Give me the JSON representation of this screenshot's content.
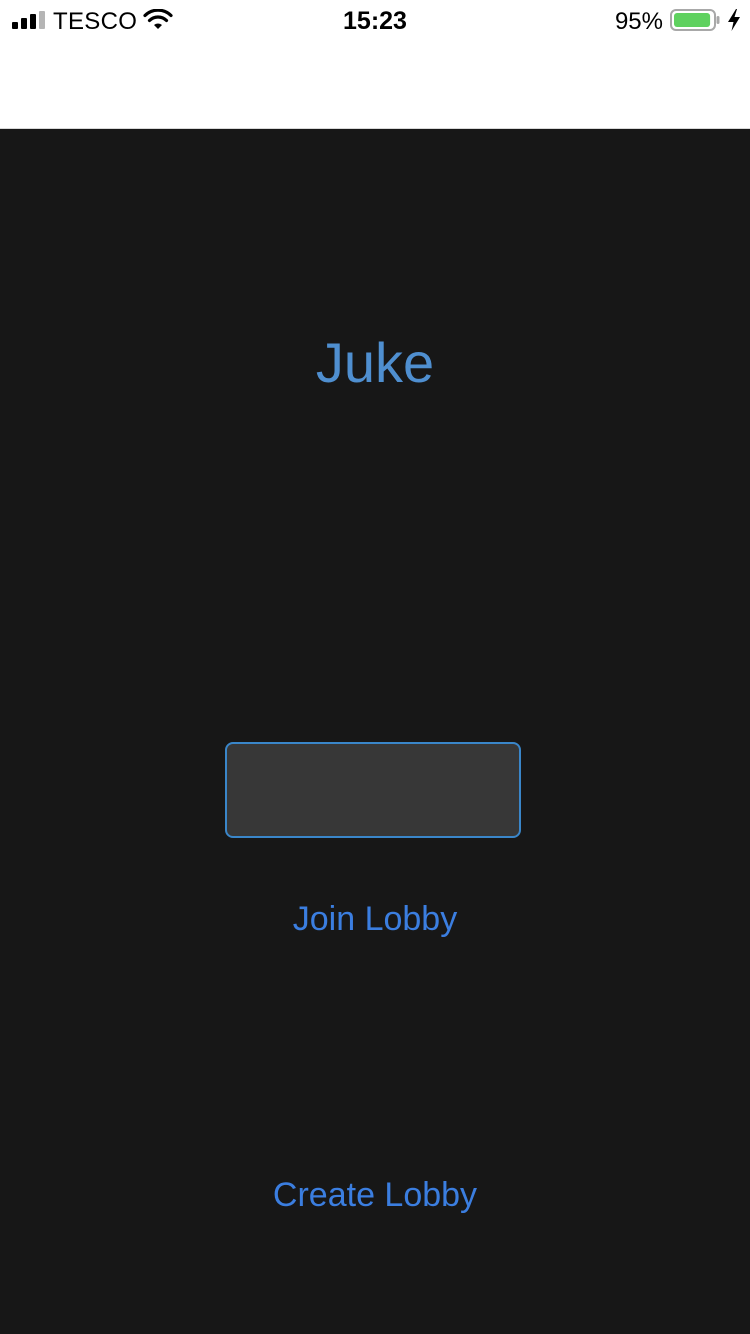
{
  "status_bar": {
    "carrier": "TESCO",
    "time": "15:23",
    "battery_percent": "95%",
    "battery_level": 0.95,
    "battery_color": "#5fd15f",
    "icons": [
      "signal-icon",
      "wifi-icon",
      "battery-icon",
      "charging-bolt-icon"
    ]
  },
  "app": {
    "title": "Juke",
    "title_color": "#4f8fd0",
    "background_color": "#171717",
    "accent_color": "#3b7ee0"
  },
  "lobby_code_input": {
    "value": "",
    "placeholder": ""
  },
  "buttons": {
    "join_label": "Join Lobby",
    "create_label": "Create Lobby"
  }
}
